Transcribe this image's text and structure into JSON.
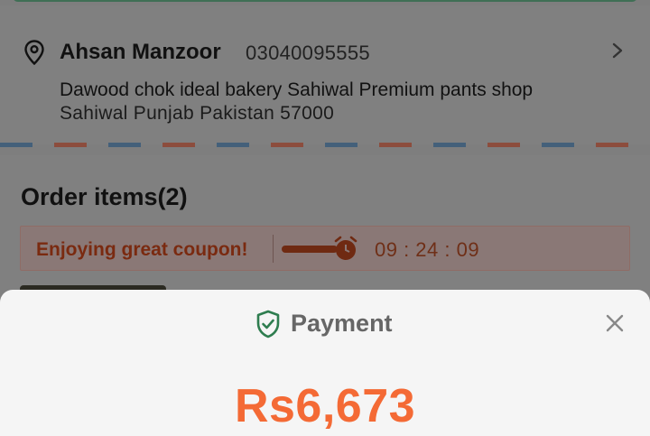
{
  "address": {
    "name": "Ahsan Manzoor",
    "phone": "03040095555",
    "line1": "Dawood chok ideal bakery Sahiwal Premium pants shop",
    "line2": "Sahiwal Punjab Pakistan 57000",
    "icon": "location-pin-icon",
    "chevron_icon": "chevron-right-icon"
  },
  "order": {
    "title": "Order items(2)",
    "coupon_text": "Enjoying great coupon!",
    "countdown": "09 : 24 : 09",
    "clock_icon": "alarm-clock-icon"
  },
  "payment": {
    "title": "Payment",
    "amount": "Rs6,673",
    "shield_icon": "shield-check-icon",
    "close_icon": "close-icon"
  },
  "colors": {
    "accent_orange": "#f46a35",
    "shield_green": "#2e7d4f",
    "coupon_red": "#c8401a",
    "overlay_gray": "#7e7e7e"
  }
}
